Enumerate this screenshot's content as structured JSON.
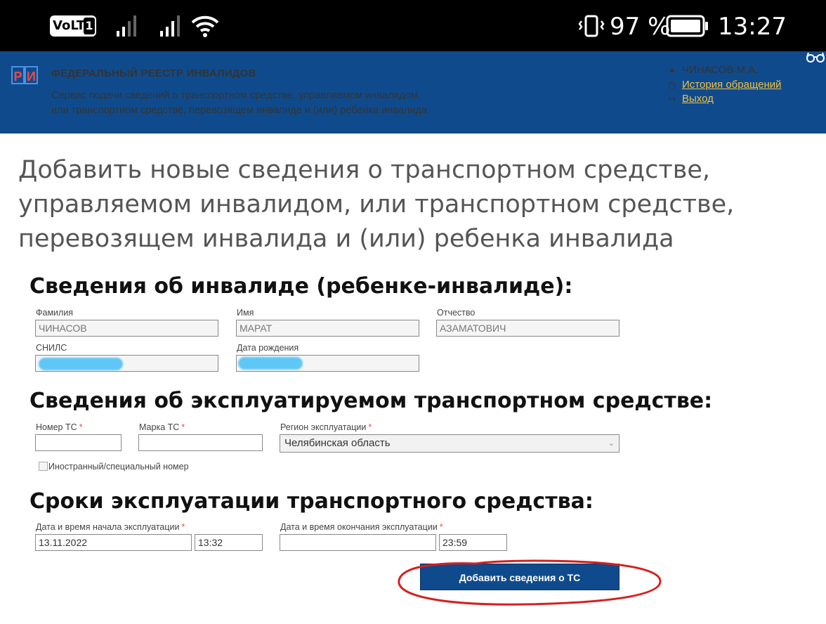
{
  "status_bar": {
    "volte": "VoLTE",
    "sim": "1",
    "battery": "97 %",
    "time": "13:27"
  },
  "header": {
    "logo_left": "Р",
    "logo_right": "И",
    "brand": "ФЕДЕРАЛЬНЫЙ РЕЕСТР ИНВАЛИДОВ",
    "subtitle_line1": "Сервис подачи сведений о транспортном средстве, управляемом инвалидом,",
    "subtitle_line2": "или транспортном средстве, перевозящем инвалида и (или) ребенка инвалида",
    "user": "ЧИНАСОВ М.А.",
    "history_link": "История обращений",
    "logout_link": "Выход"
  },
  "page": {
    "title_line1": "Добавить новые сведения о транспортном средстве,",
    "title_line2": "управляемом инвалидом, или транспортном средстве,",
    "title_line3": "перевозящем инвалида и (или) ребенка инвалида"
  },
  "person": {
    "heading": "Сведения об инвалиде (ребенке-инвалиде):",
    "surname_label": "Фамилия",
    "surname": "ЧИНАСОВ",
    "name_label": "Имя",
    "name": "МАРАТ",
    "patronymic_label": "Отчество",
    "patronymic": "АЗАМАТОВИЧ",
    "snils_label": "СНИЛС",
    "birthdate_label": "Дата рождения"
  },
  "vehicle": {
    "heading": "Сведения об эксплуатируемом транспортном средстве:",
    "number_label": "Номер ТС",
    "brand_label": "Марка ТС",
    "region_label": "Регион эксплуатации",
    "region_value": "Челябинская область",
    "required_mark": "*",
    "foreign_label": "Иностранный/специальный номер"
  },
  "period": {
    "heading": "Сроки эксплуатации транспортного средства:",
    "start_label": "Дата и время начала эксплуатации",
    "start_date": "13.11.2022",
    "start_time": "13:32",
    "end_label": "Дата и время окончания эксплуатации",
    "end_date": "",
    "end_time": "23:59"
  },
  "submit_label": "Добавить сведения о ТС",
  "colors": {
    "header_bg": "#0f4b8c",
    "link": "#f0c040",
    "required": "#d9534f",
    "annotation": "#d42020"
  }
}
